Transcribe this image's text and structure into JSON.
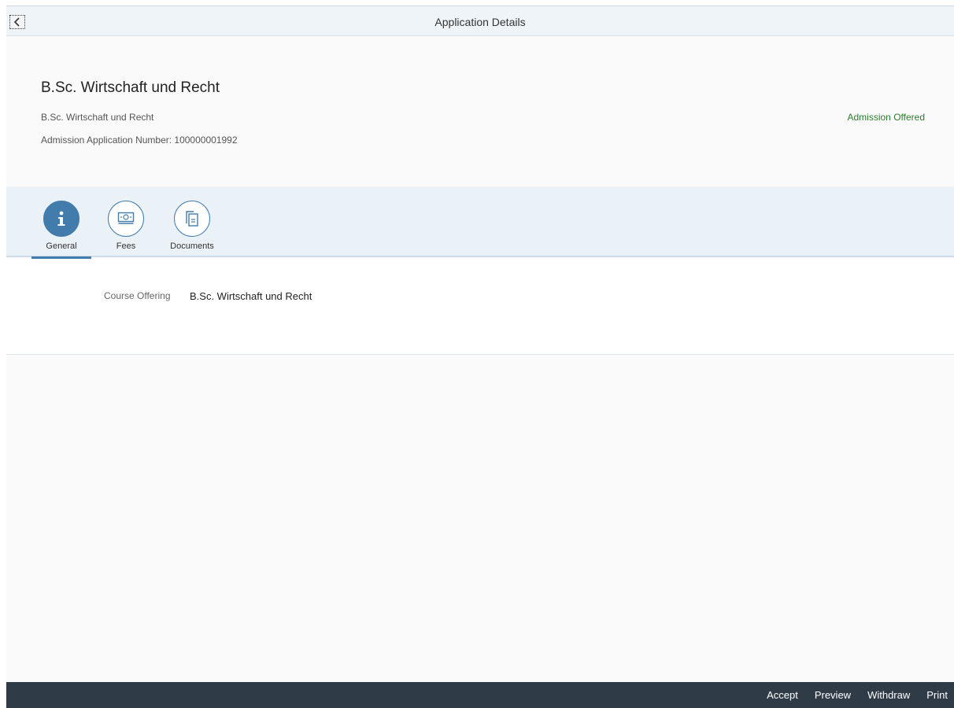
{
  "shell": {
    "title": "Application Details",
    "back_icon": "chevron-left-icon"
  },
  "header": {
    "title": "B.Sc. Wirtschaft und Recht",
    "subtitle": "B.Sc. Wirtschaft und Recht",
    "application_number": "Admission Application Number: 100000001992",
    "status": "Admission Offered",
    "status_color": "#2b7d2b"
  },
  "tabs": [
    {
      "label": "General",
      "icon": "info-icon",
      "selected": true
    },
    {
      "label": "Fees",
      "icon": "money-bills-icon",
      "selected": false
    },
    {
      "label": "Documents",
      "icon": "documents-icon",
      "selected": false
    }
  ],
  "general": {
    "course_offering_label": "Course Offering",
    "course_offering_value": "B.Sc. Wirtschaft und Recht"
  },
  "footer": {
    "accept": "Accept",
    "preview": "Preview",
    "withdraw": "Withdraw",
    "print": "Print"
  },
  "colors": {
    "accent": "#427cac",
    "footer_bg": "#2f3c48",
    "shell_bg": "#eff4f9"
  }
}
